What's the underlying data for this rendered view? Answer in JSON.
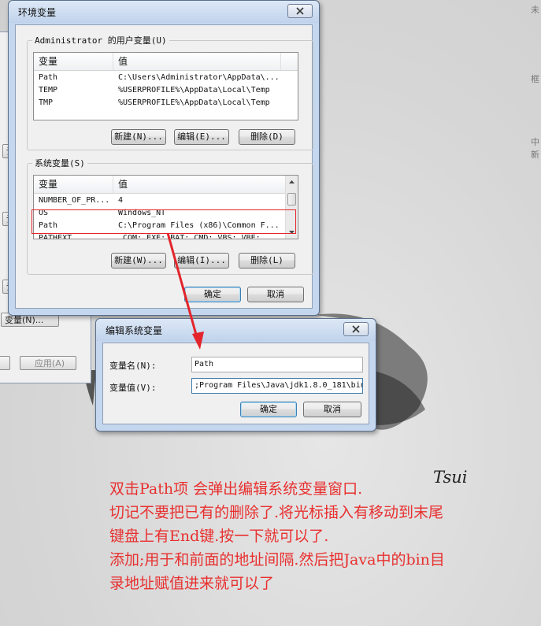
{
  "background": {
    "edge_fragments": [
      "未",
      "框",
      "中",
      "新"
    ]
  },
  "behind_window": {
    "partial_buttons": [
      "设",
      "设",
      "设"
    ],
    "env_button": "变量(N)...",
    "apply_button": "应用(A)"
  },
  "env_dialog": {
    "title": "环境变量",
    "user_group": {
      "label": "Administrator 的用户变量(U)",
      "headers": [
        "变量",
        "值"
      ],
      "rows": [
        {
          "name": "Path",
          "value": "C:\\Users\\Administrator\\AppData\\..."
        },
        {
          "name": "TEMP",
          "value": "%USERPROFILE%\\AppData\\Local\\Temp"
        },
        {
          "name": "TMP",
          "value": "%USERPROFILE%\\AppData\\Local\\Temp"
        }
      ],
      "buttons": {
        "new": "新建(N)...",
        "edit": "编辑(E)...",
        "delete": "删除(D)"
      }
    },
    "system_group": {
      "label": "系统变量(S)",
      "headers": [
        "变量",
        "值"
      ],
      "rows": [
        {
          "name": "NUMBER_OF_PR...",
          "value": "4"
        },
        {
          "name": "OS",
          "value": "Windows_NT"
        },
        {
          "name": "Path",
          "value": "C:\\Program Files (x86)\\Common F..."
        },
        {
          "name": "PATHEXT",
          "value": ".COM;.EXE;.BAT;.CMD;.VBS;.VBE;..."
        }
      ],
      "buttons": {
        "new": "新建(W)...",
        "edit": "编辑(I)...",
        "delete": "删除(L)"
      }
    },
    "ok": "确定",
    "cancel": "取消"
  },
  "edit_dialog": {
    "title": "编辑系统变量",
    "name_label": "变量名(N):",
    "name_value": "Path",
    "value_label": "变量值(V):",
    "value_value": ";Program Files\\Java\\jdk1.8.0_181\\bin",
    "ok": "确定",
    "cancel": "取消"
  },
  "annotation": {
    "lines": [
      "双击Path项 会弹出编辑系统变量窗口.",
      "切记不要把已有的删除了.将光标插入有移动到末尾",
      "键盘上有End键.按一下就可以了.",
      "添加;用于和前面的地址间隔.然后把Java中的bin目",
      "录地址赋值进来就可以了"
    ],
    "signature": "Tsui"
  },
  "colors": {
    "annotation": "#e8302f",
    "title_bar": "#c5d7ee",
    "highlight": "#e3242b"
  }
}
